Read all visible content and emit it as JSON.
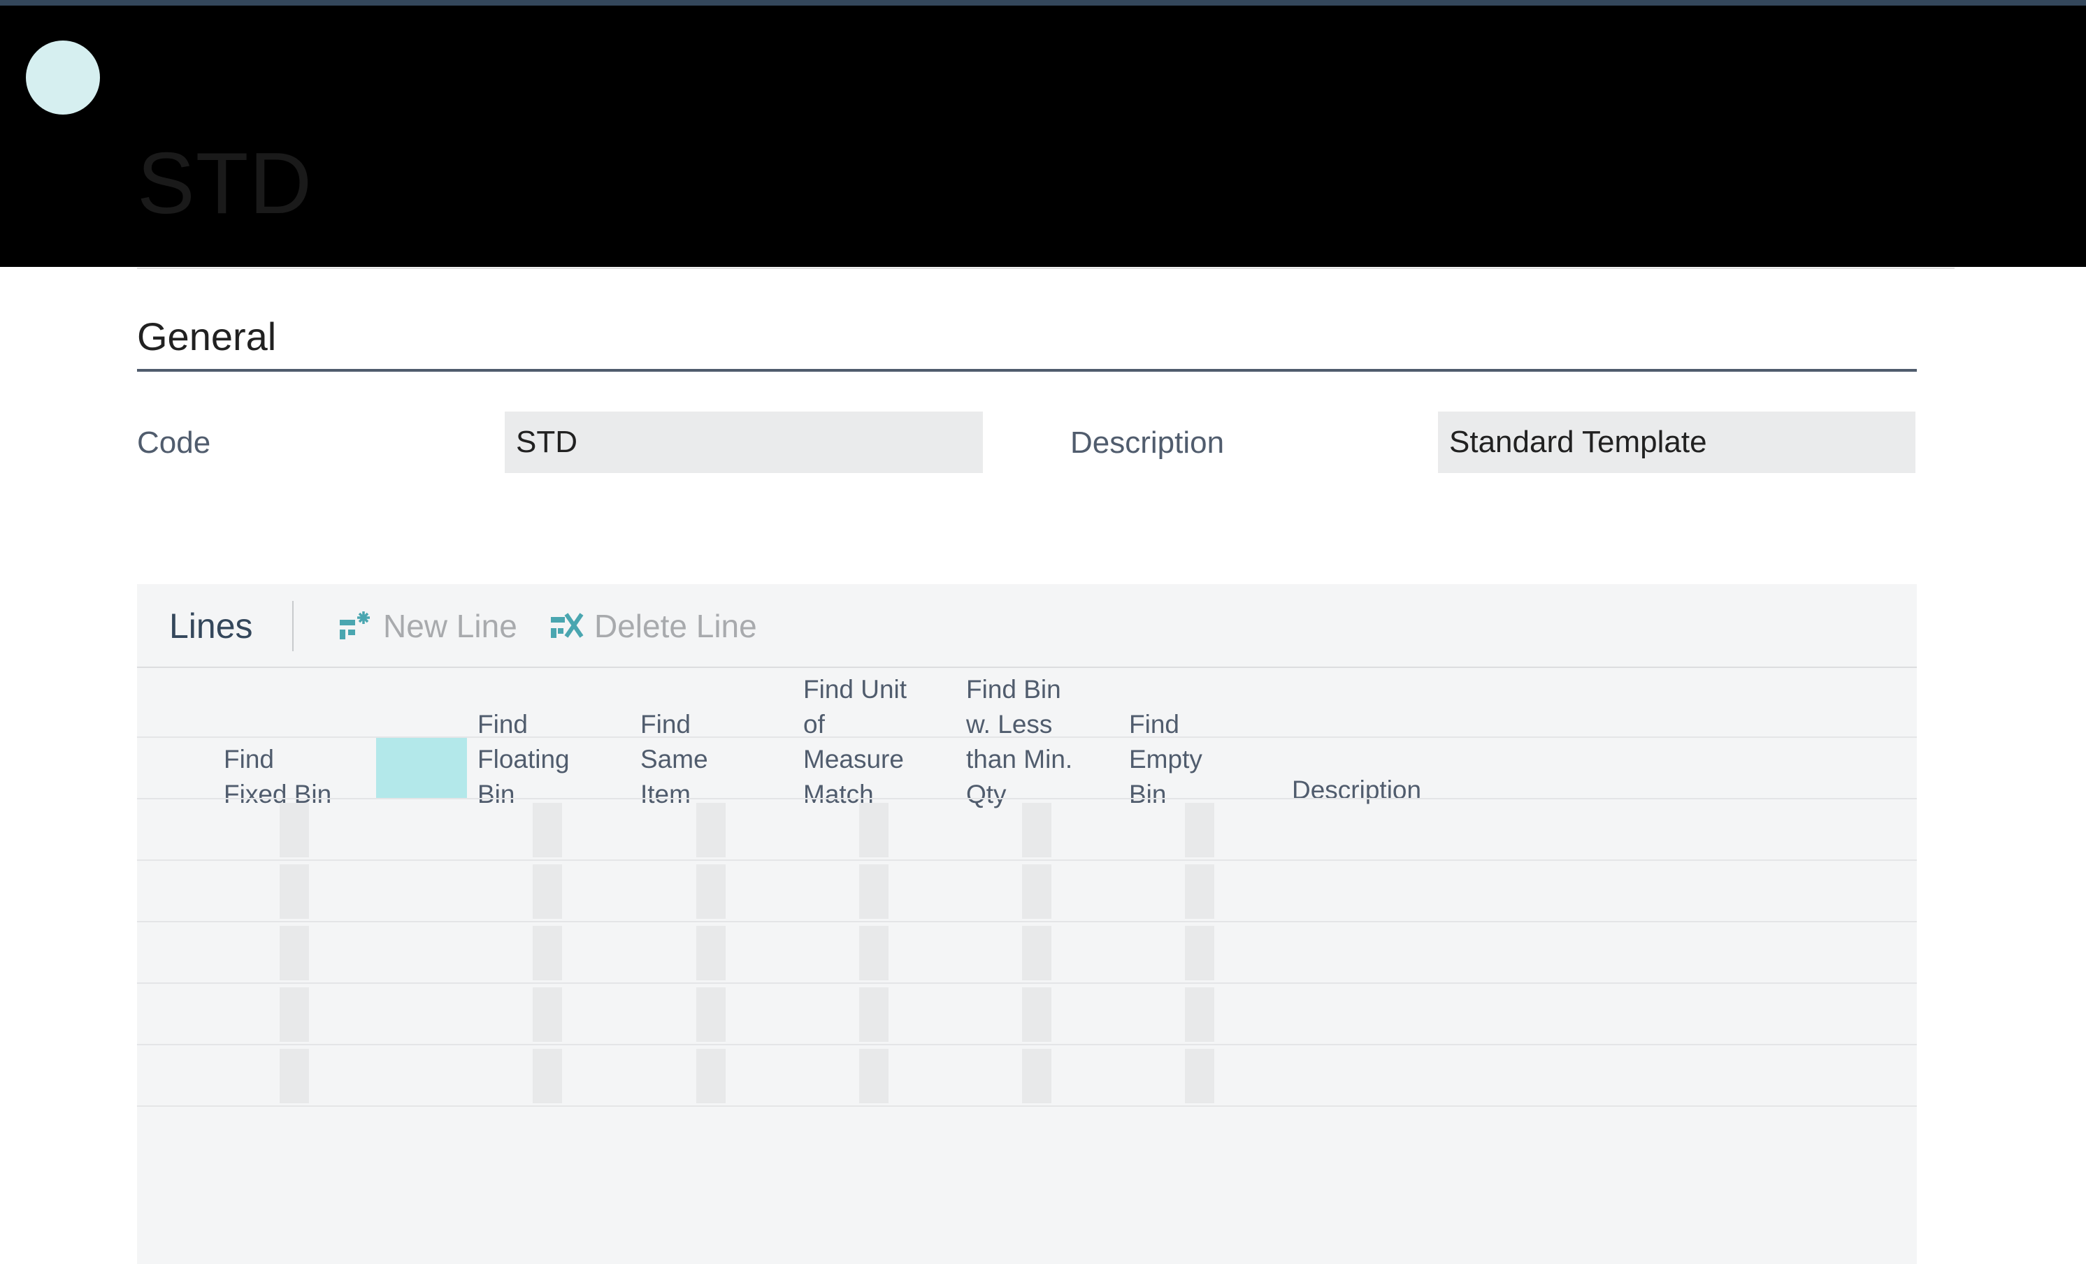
{
  "header": {
    "title": "STD"
  },
  "general": {
    "section_title": "General",
    "code_label": "Code",
    "code_value": "STD",
    "description_label": "Description",
    "description_value": "Standard Template"
  },
  "lines": {
    "title": "Lines",
    "actions": {
      "new_line": "New Line",
      "delete_line": "Delete Line"
    },
    "columns": [
      "Find\nFixed Bin",
      "Find\nFloating\nBin",
      "Find\nSame\nItem",
      "Find Unit\nof\nMeasure\nMatch",
      "Find Bin\nw. Less\nthan Min.\nQty",
      "Find\nEmpty\nBin",
      "Description"
    ],
    "rows": [
      {
        "find_fixed_bin": false,
        "find_floating_bin": false,
        "find_same_item": false,
        "find_uom_match": false,
        "find_bin_less_min_qty": false,
        "find_empty_bin": false,
        "description": ""
      },
      {
        "find_fixed_bin": false,
        "find_floating_bin": false,
        "find_same_item": false,
        "find_uom_match": false,
        "find_bin_less_min_qty": false,
        "find_empty_bin": false,
        "description": ""
      },
      {
        "find_fixed_bin": false,
        "find_floating_bin": false,
        "find_same_item": false,
        "find_uom_match": false,
        "find_bin_less_min_qty": false,
        "find_empty_bin": false,
        "description": ""
      },
      {
        "find_fixed_bin": false,
        "find_floating_bin": false,
        "find_same_item": false,
        "find_uom_match": false,
        "find_bin_less_min_qty": false,
        "find_empty_bin": false,
        "description": ""
      },
      {
        "find_fixed_bin": false,
        "find_floating_bin": false,
        "find_same_item": false,
        "find_uom_match": false,
        "find_bin_less_min_qty": false,
        "find_empty_bin": false,
        "description": ""
      }
    ]
  },
  "colors": {
    "accent": "#4aa6b0",
    "header_bg": "#000000",
    "selected_cell": "#b3e8ea"
  },
  "icons": {
    "new_line": "new-line-icon",
    "delete_line": "delete-line-icon",
    "avatar": "avatar"
  }
}
